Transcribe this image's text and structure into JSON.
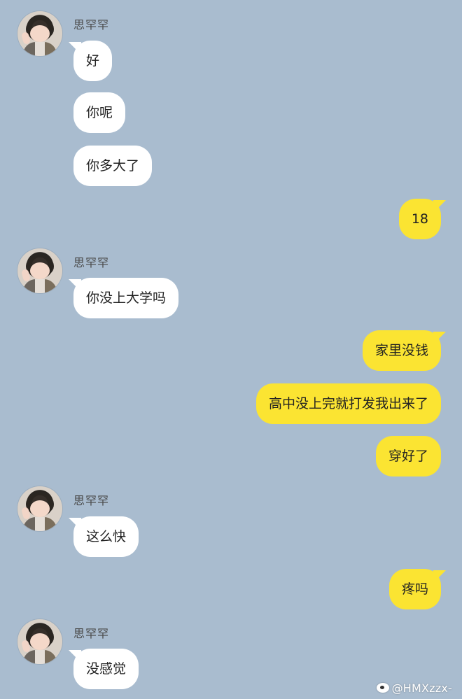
{
  "conversation": {
    "contact_name": "思罕罕",
    "messages": [
      {
        "side": "left",
        "text": "好"
      },
      {
        "side": "left",
        "text": "你呢"
      },
      {
        "side": "left",
        "text": "你多大了"
      },
      {
        "side": "right",
        "text": "18"
      },
      {
        "side": "left",
        "text": "你没上大学吗"
      },
      {
        "side": "right",
        "text": "家里没钱"
      },
      {
        "side": "right",
        "text": "高中没上完就打发我出来了"
      },
      {
        "side": "right",
        "text": "穿好了"
      },
      {
        "side": "left",
        "text": "这么快"
      },
      {
        "side": "right",
        "text": "疼吗"
      },
      {
        "side": "left",
        "text": "没感觉"
      }
    ]
  },
  "watermark": {
    "icon": "weibo-icon",
    "text": "@HMXzzx-"
  },
  "colors": {
    "background": "#a9bccf",
    "incoming_bubble": "#ffffff",
    "outgoing_bubble": "#fbe432"
  }
}
